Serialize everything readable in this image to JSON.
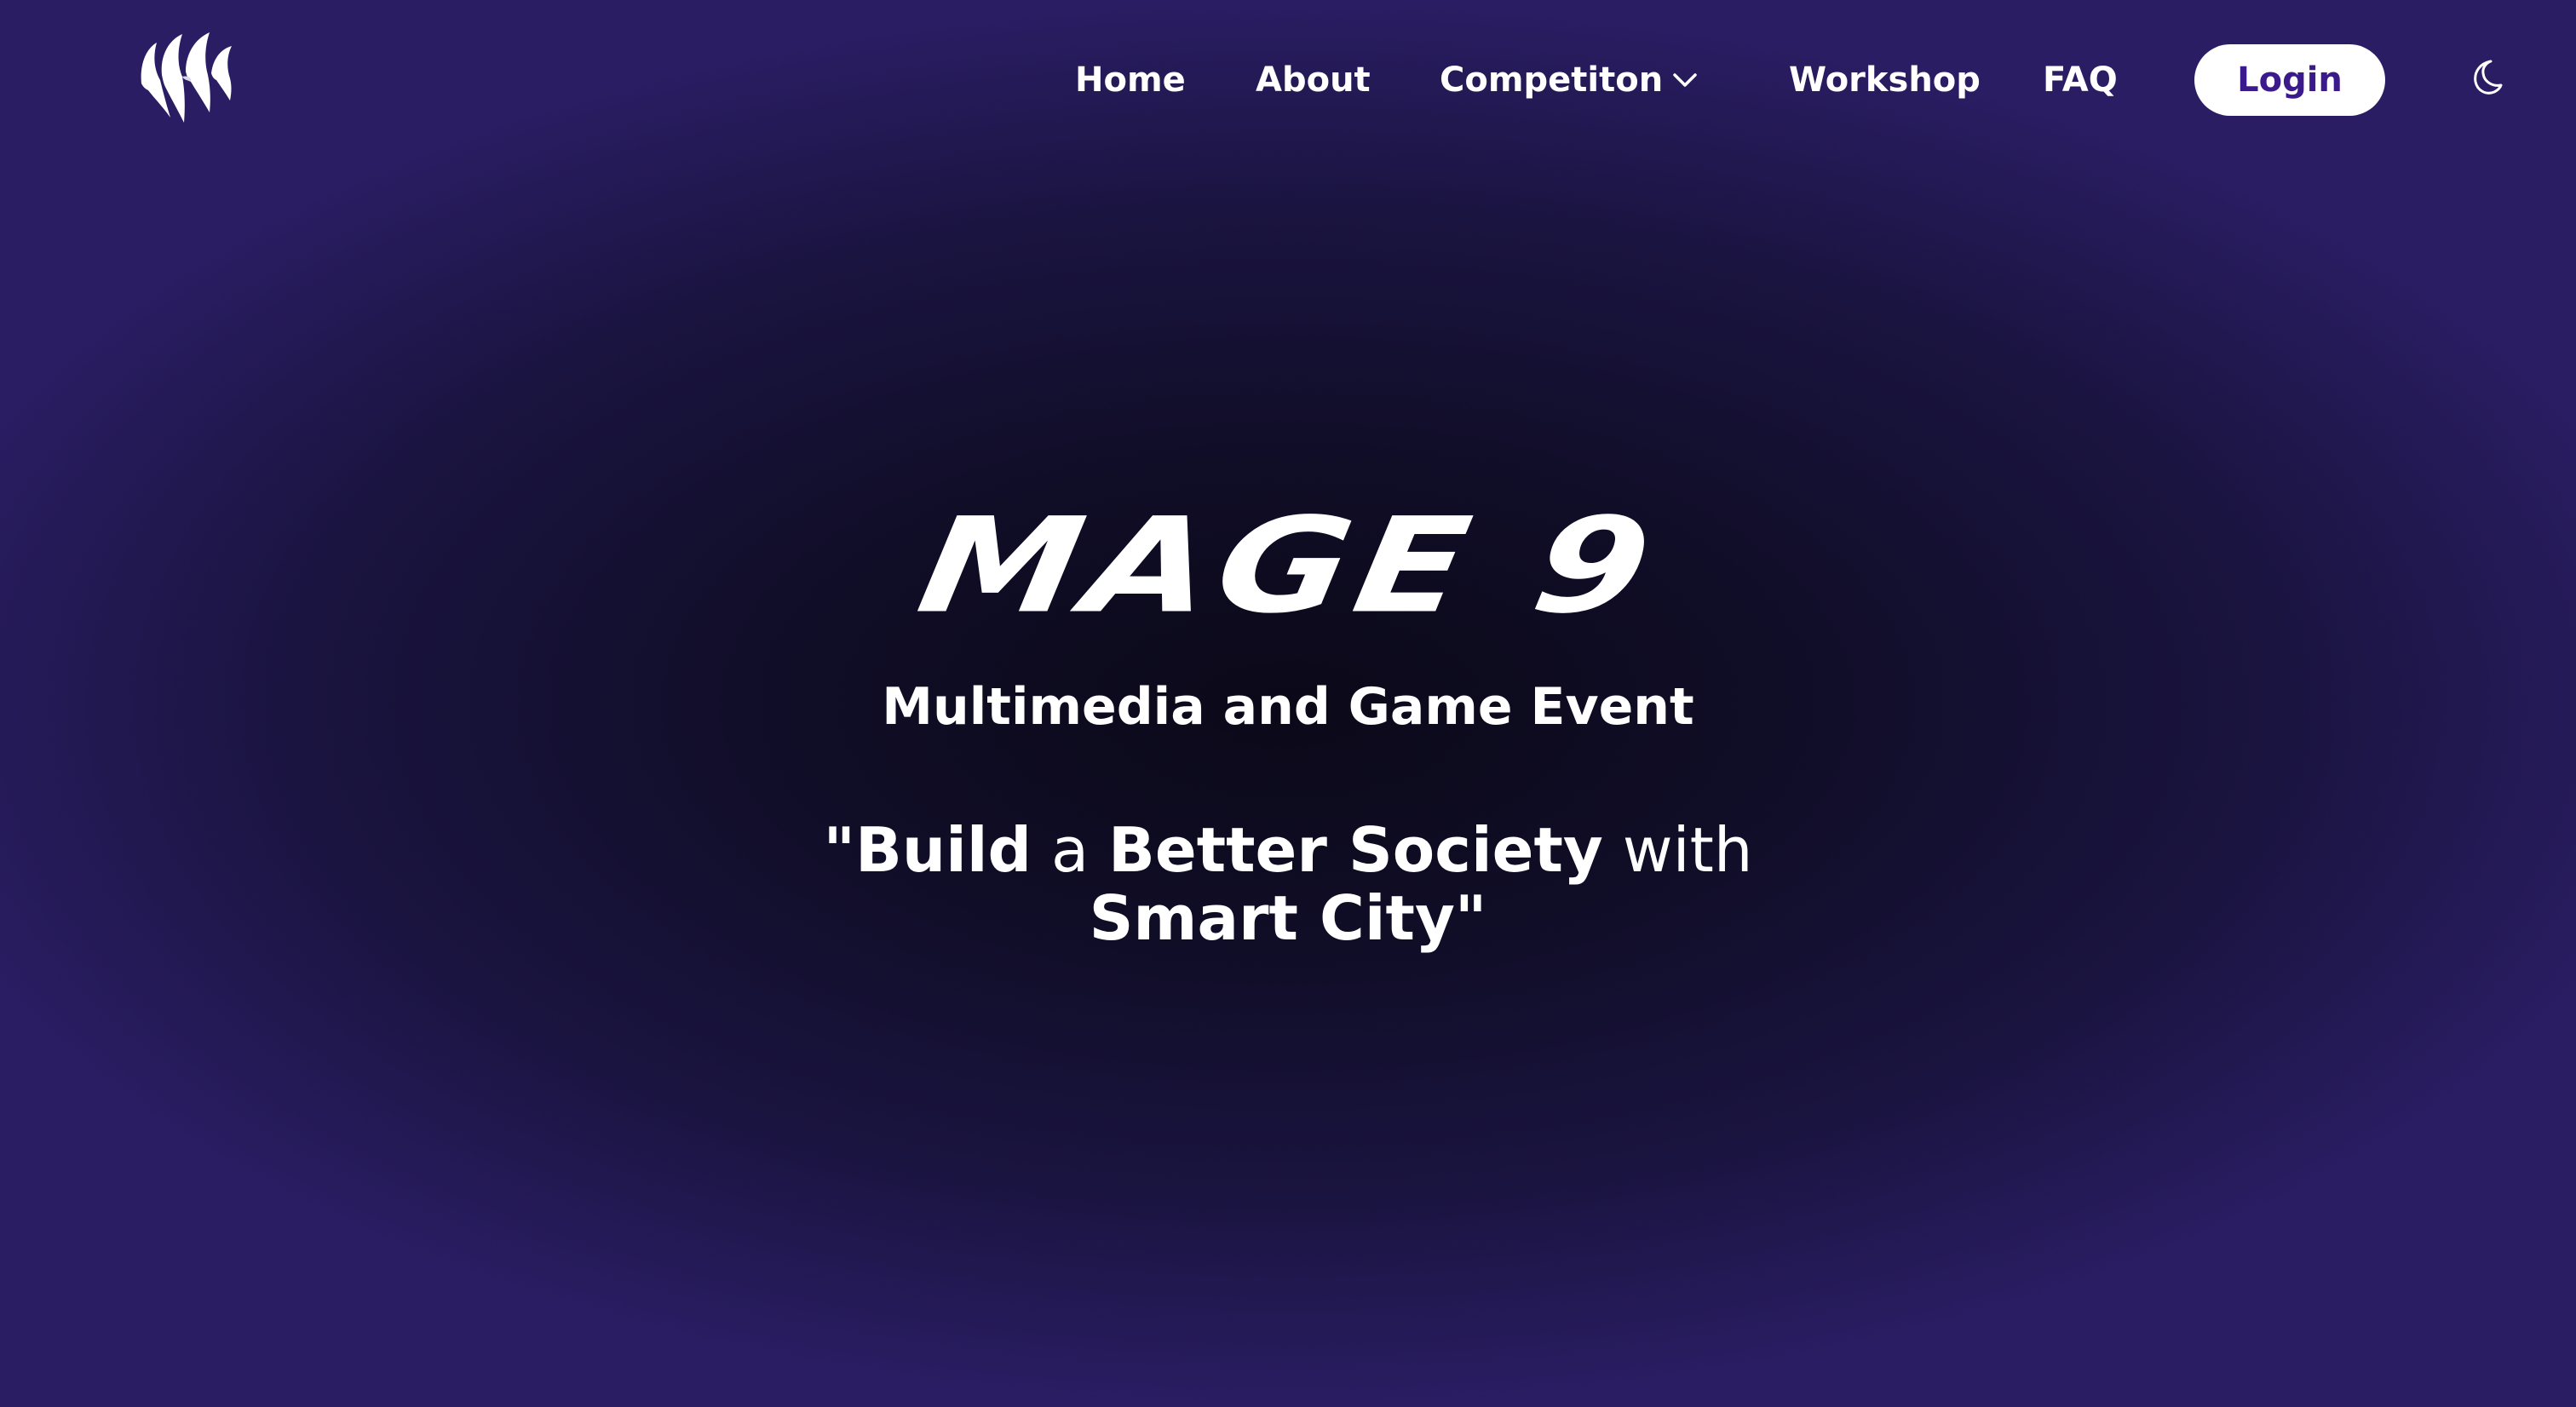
{
  "nav": {
    "logo_icon": "mage-claw-logo-icon",
    "links": [
      "Home",
      "About",
      "Competiton",
      "Workshop",
      "FAQ"
    ],
    "competition_dropdown_icon": "chevron-down-icon",
    "login_label": "Login",
    "theme_toggle_icon": "moon-icon"
  },
  "hero": {
    "title": "MAGE 9",
    "subtitle": "Multimedia and Game Event",
    "tagline": {
      "part1": "\"Build",
      "part2": " a ",
      "part3": "Better Society",
      "part4": " with",
      "part5": "Smart City\""
    }
  },
  "colors": {
    "background_edge": "#2a1d63",
    "background_center": "#0b0918",
    "text": "#ffffff",
    "login_text": "#3b1a8c",
    "login_bg": "#ffffff"
  }
}
